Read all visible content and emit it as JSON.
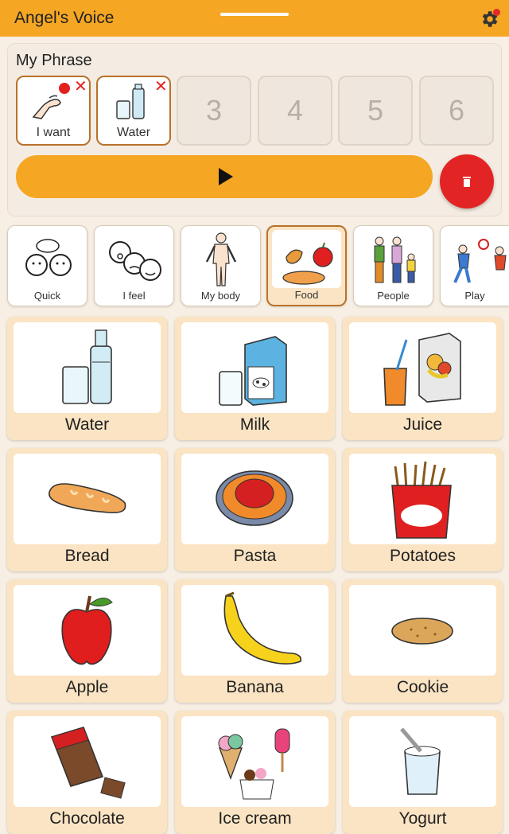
{
  "appbar": {
    "title": "Angel's Voice",
    "settings_icon": "gear-icon"
  },
  "phrase": {
    "title": "My Phrase",
    "slots": [
      {
        "label": "I want",
        "icon": "hand-gesture-icon"
      },
      {
        "label": "Water",
        "icon": "water-icon"
      },
      {
        "number": "3"
      },
      {
        "number": "4"
      },
      {
        "number": "5"
      },
      {
        "number": "6"
      }
    ],
    "play_icon": "play-icon",
    "delete_icon": "trash-icon"
  },
  "categories": [
    {
      "label": "Quick",
      "icon": "speech-bubbles-icon"
    },
    {
      "label": "I feel",
      "icon": "faces-icon"
    },
    {
      "label": "My body",
      "icon": "body-icon"
    },
    {
      "label": "Food",
      "icon": "food-icon",
      "selected": true
    },
    {
      "label": "People",
      "icon": "family-icon"
    },
    {
      "label": "Play",
      "icon": "children-playing-icon"
    }
  ],
  "tiles": [
    {
      "label": "Water",
      "icon": "water-icon"
    },
    {
      "label": "Milk",
      "icon": "milk-icon"
    },
    {
      "label": "Juice",
      "icon": "juice-icon"
    },
    {
      "label": "Bread",
      "icon": "bread-icon"
    },
    {
      "label": "Pasta",
      "icon": "pasta-icon"
    },
    {
      "label": "Potatoes",
      "icon": "fries-icon"
    },
    {
      "label": "Apple",
      "icon": "apple-icon"
    },
    {
      "label": "Banana",
      "icon": "banana-icon"
    },
    {
      "label": "Cookie",
      "icon": "cookie-icon"
    },
    {
      "label": "Chocolate",
      "icon": "chocolate-icon"
    },
    {
      "label": "Ice cream",
      "icon": "ice-cream-icon"
    },
    {
      "label": "Yogurt",
      "icon": "yogurt-icon"
    }
  ],
  "colors": {
    "accent": "#f5a623",
    "delete": "#e32424",
    "tile_bg": "#fbe4c3",
    "selected_border": "#b9722b"
  }
}
